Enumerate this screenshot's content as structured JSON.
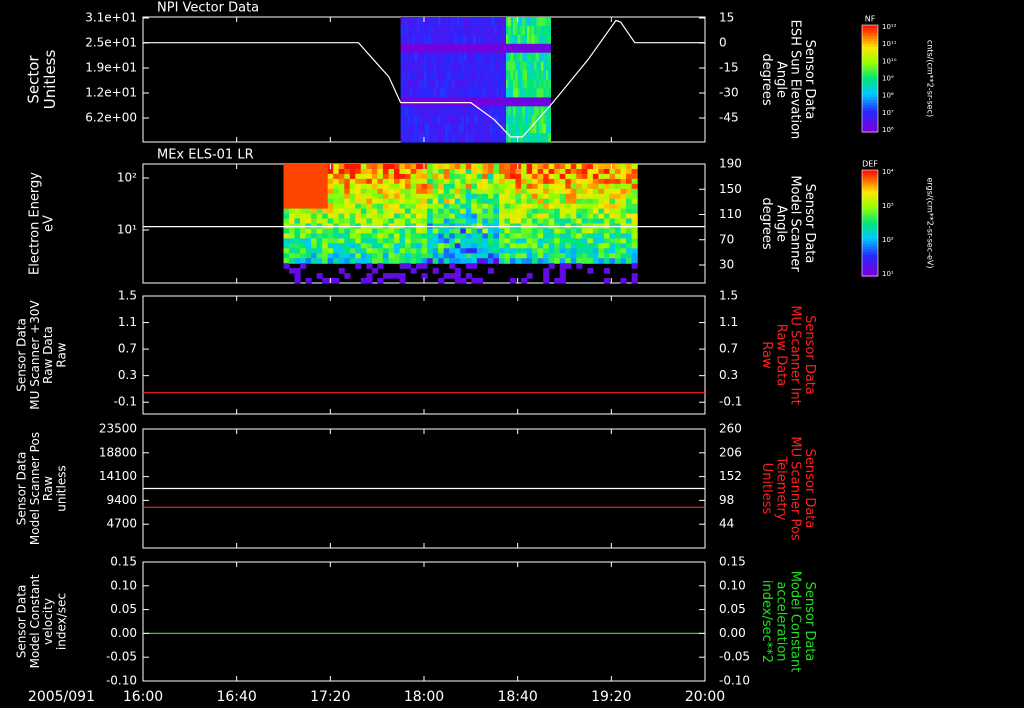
{
  "colors": {
    "background": "#000000",
    "axis": "#ffffff",
    "red_trace": "#ff2020",
    "green_trace": "#20e020",
    "white_trace": "#ffffff"
  },
  "time_axis": {
    "date_label": "2005/091",
    "tick_labels": [
      "16:00",
      "16:40",
      "17:20",
      "18:00",
      "18:40",
      "19:20",
      "20:00"
    ],
    "range": [
      "16:00",
      "20:00"
    ]
  },
  "chart_data": [
    {
      "id": "npi",
      "type": "heatmap",
      "title": "NPI Vector Data",
      "ylabel_left": [
        "Sector",
        "Unitless"
      ],
      "ytick_left": [
        "3.1e+01",
        "2.5e+01",
        "1.9e+01",
        "1.2e+01",
        "6.2e+00"
      ],
      "ylabel_right": [
        "Sensor Data",
        "ESH Sun Elevation",
        "Angle",
        "degrees"
      ],
      "ytick_right": [
        "15",
        "0",
        "-15",
        "-30",
        "-45"
      ],
      "yrange_right": [
        -58,
        15
      ],
      "colorbar": {
        "label": "NF",
        "units": "cnts/(cm**2-sr-sec)",
        "ticks": [
          "10¹²",
          "10¹¹",
          "10¹⁰",
          "10⁹",
          "10⁸",
          "10⁷",
          "10⁶"
        ]
      },
      "overlay_line": {
        "name": "ESH Sun Elevation Angle",
        "color": "#ffffff",
        "x": [
          "16:00",
          "17:32",
          "17:45",
          "17:50",
          "18:10",
          "18:20",
          "18:30",
          "18:37",
          "18:42",
          "18:55",
          "19:10",
          "19:22",
          "19:24",
          "19:30",
          "20:00"
        ],
        "y": [
          0,
          0,
          -20,
          -35,
          -35,
          -35,
          -45,
          -55,
          -55,
          -35,
          -10,
          13,
          12,
          0,
          0
        ]
      },
      "image_extent": [
        "17:50",
        "18:54"
      ]
    },
    {
      "id": "els",
      "type": "heatmap",
      "title": "MEx ELS-01 LR",
      "ylabel_left": [
        "Electron Energy",
        "eV"
      ],
      "ytick_left": [
        "10²",
        "10¹"
      ],
      "ylabel_right": [
        "Sensor Data",
        "Model Scanner",
        "Angle",
        "degrees"
      ],
      "ytick_right": [
        "190",
        "150",
        "110",
        "70",
        "30"
      ],
      "yrange_right": [
        0,
        190
      ],
      "colorbar": {
        "label": "DEF",
        "units": "ergs/(cm**2-sr-sec-eV)",
        "ticks": [
          "10⁴",
          "10³",
          "10²",
          "10¹"
        ]
      },
      "overlay_line": {
        "name": "Model Scanner Angle",
        "color": "#ffffff",
        "x": [
          "16:00",
          "20:00"
        ],
        "y": [
          90,
          90
        ]
      },
      "image_extent": [
        "17:00",
        "19:31"
      ]
    },
    {
      "id": "mu30v",
      "type": "line",
      "ylabel_left": [
        "Sensor Data",
        "MU Scanner +30V",
        "Raw Data",
        "Raw"
      ],
      "ytick_left": [
        "1.5",
        "1.1",
        "0.7",
        "0.3",
        "-0.1"
      ],
      "yrange_left": [
        -0.33,
        1.5
      ],
      "ylabel_right": [
        "Sensor Data",
        "MU Scanner Int",
        "Raw Data",
        "Raw"
      ],
      "ytick_right": [
        "1.5",
        "1.1",
        "0.7",
        "0.3",
        "-0.1"
      ],
      "series": [
        {
          "name": "MU Scanner Int",
          "color": "#ff2020",
          "x": [
            "16:00",
            "20:00"
          ],
          "y": [
            0.0,
            0.0
          ]
        }
      ]
    },
    {
      "id": "scanpos",
      "type": "line",
      "ylabel_left": [
        "Sensor Data",
        "Model Scanner Pos",
        "Raw",
        "unitless"
      ],
      "ytick_left": [
        "23500",
        "18800",
        "14100",
        "9400",
        "4700"
      ],
      "yrange_left": [
        0,
        23500
      ],
      "ylabel_right": [
        "Sensor Data",
        "MU Scanner Pos",
        "Telemetry",
        "Unitless"
      ],
      "ytick_right": [
        "260",
        "206",
        "152",
        "98",
        "44"
      ],
      "yrange_right": [
        0,
        260
      ],
      "series": [
        {
          "name": "Model Scanner Pos",
          "color": "#ffffff",
          "x": [
            "16:00",
            "20:00"
          ],
          "y": [
            11750,
            11750
          ]
        },
        {
          "name": "MU Scanner Pos Telemetry",
          "color": "#ff2020",
          "x": [
            "16:00",
            "20:00"
          ],
          "y": [
            89,
            89
          ]
        }
      ]
    },
    {
      "id": "velocity",
      "type": "line",
      "ylabel_left": [
        "Sensor Data",
        "Model Constant",
        "velocity",
        "index/sec"
      ],
      "ytick_left": [
        "0.15",
        "0.10",
        "0.05",
        "0.00",
        "-0.05",
        "-0.10"
      ],
      "yrange_left": [
        -0.1,
        0.15
      ],
      "ylabel_right": [
        "Sensor Data",
        "Model Constant",
        "acceleration",
        "index/sec**2"
      ],
      "ytick_right": [
        "0.15",
        "0.10",
        "0.05",
        "0.00",
        "-0.05",
        "-0.10"
      ],
      "series": [
        {
          "name": "Model Constant acceleration",
          "color": "#20e020",
          "x": [
            "16:00",
            "20:00"
          ],
          "y": [
            0.0,
            0.0
          ]
        }
      ]
    }
  ]
}
